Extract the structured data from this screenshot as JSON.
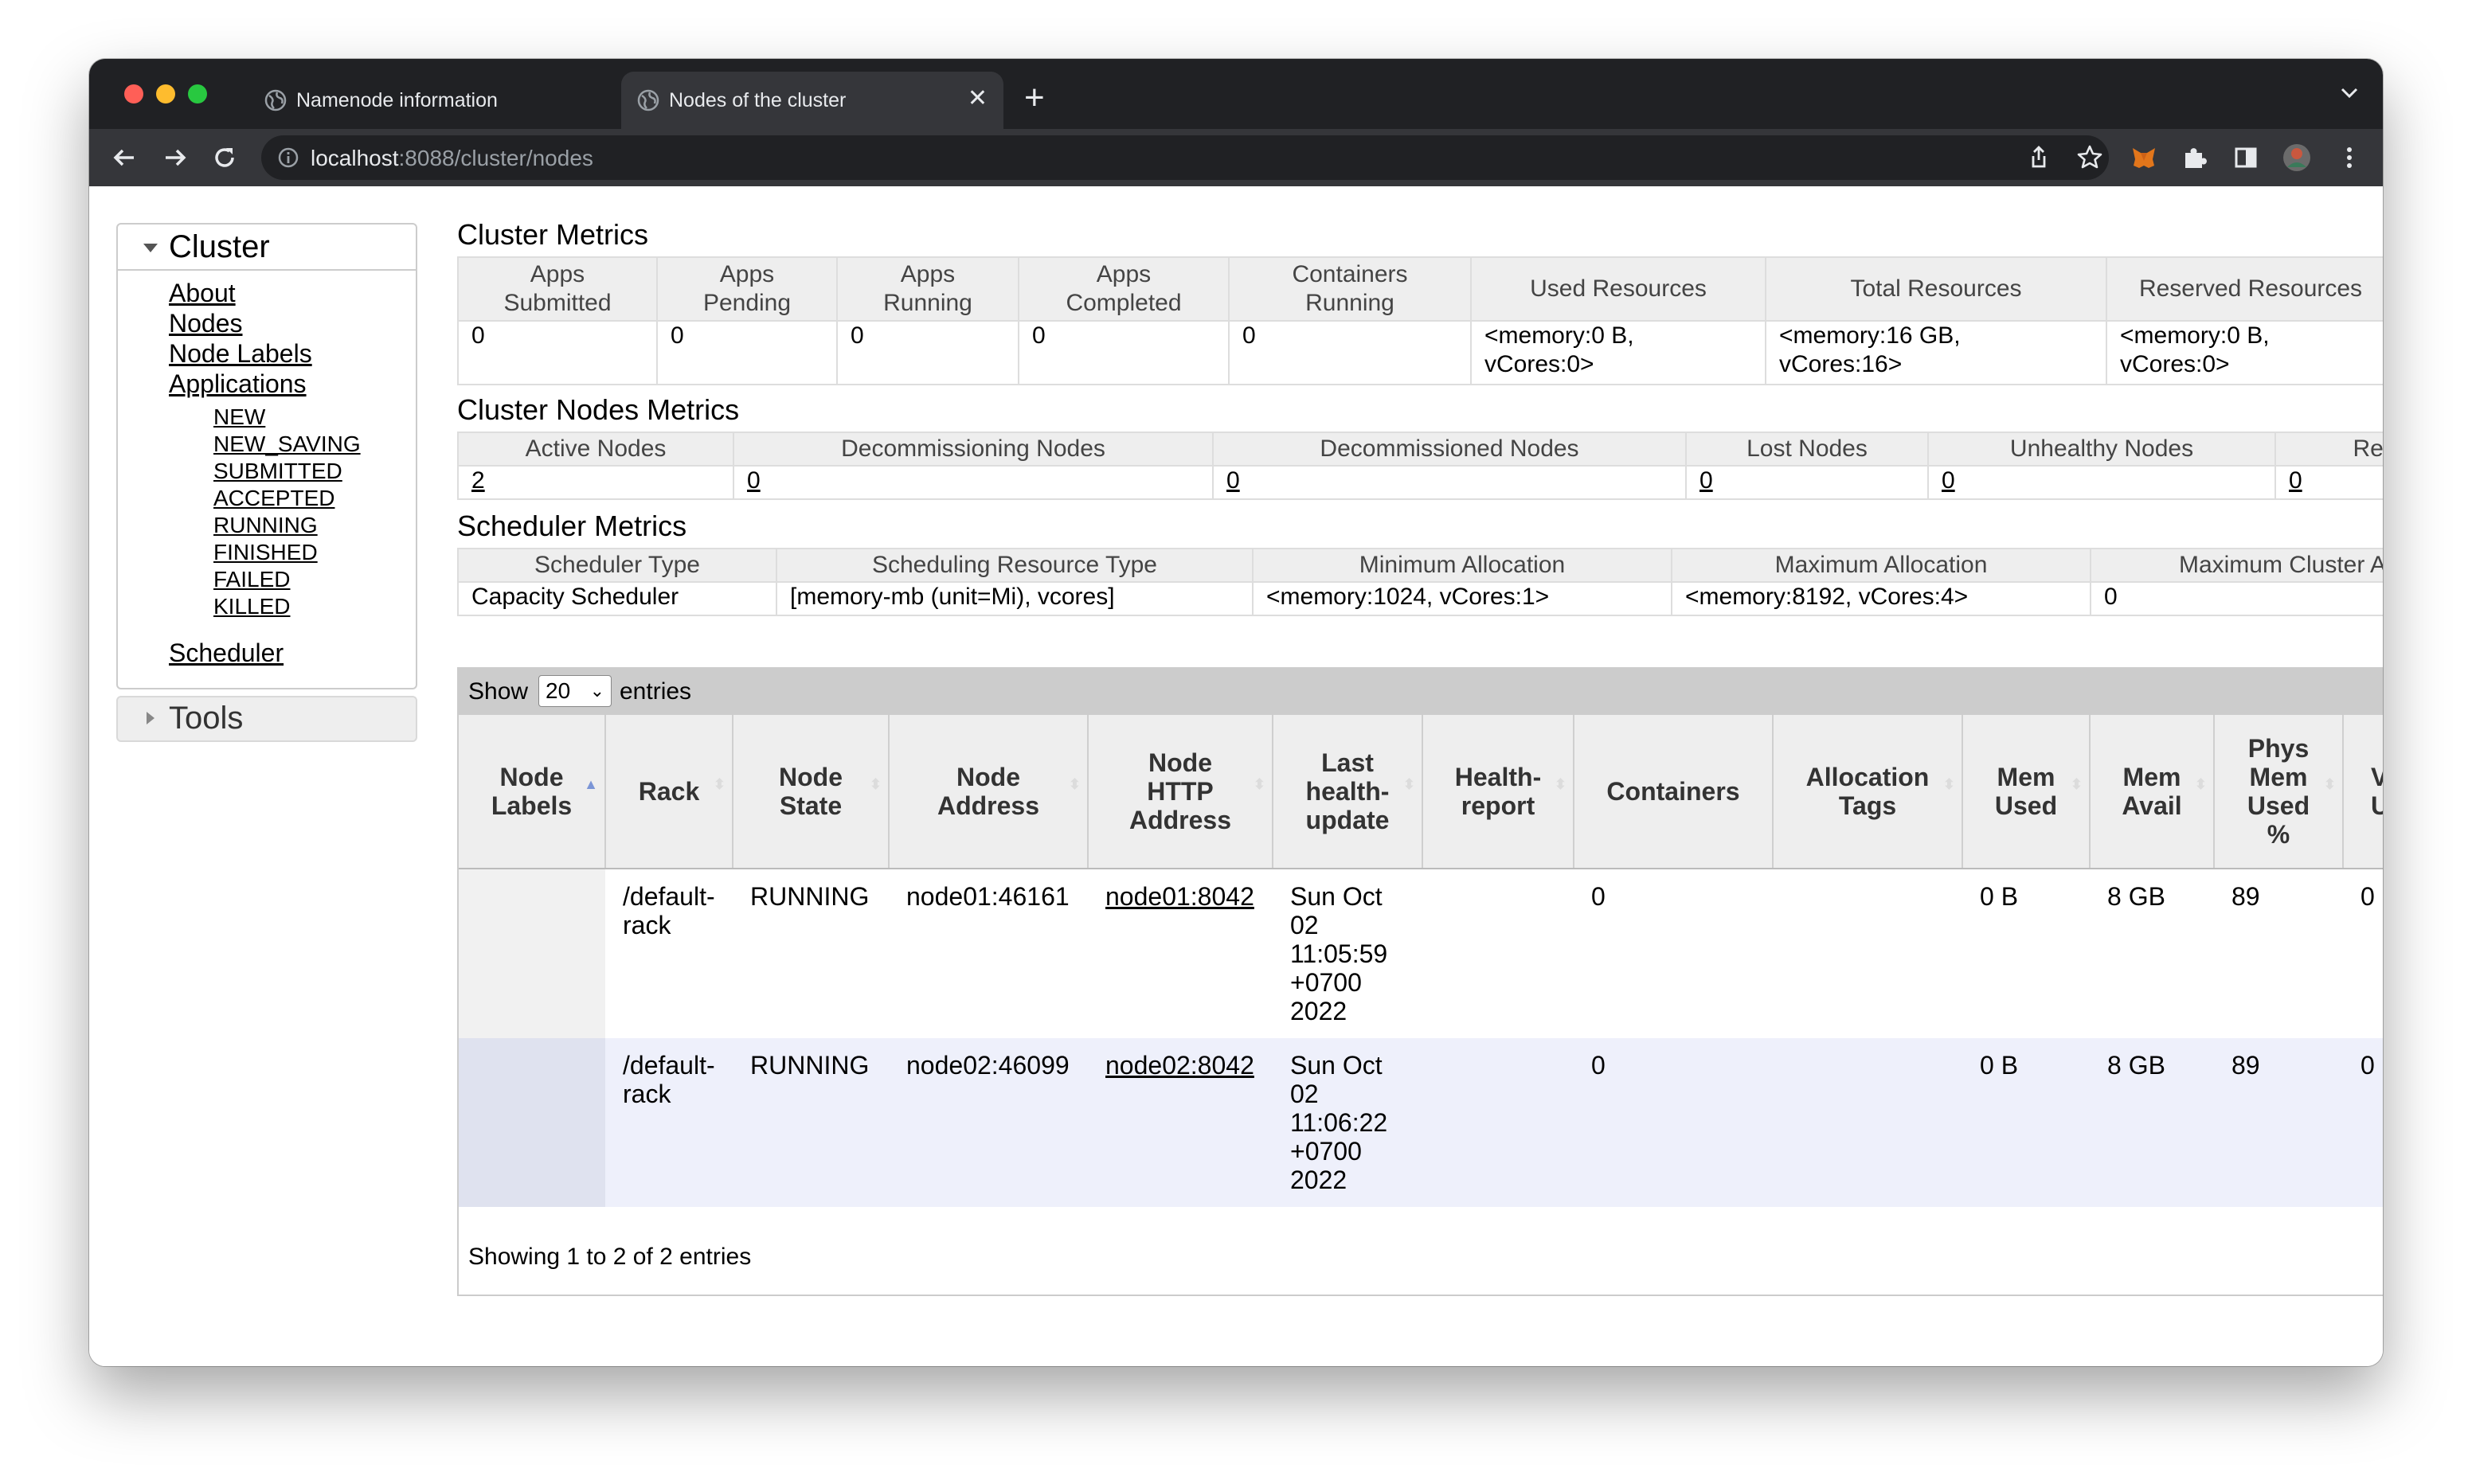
{
  "browser": {
    "tabs": [
      {
        "title": "Namenode information",
        "active": false
      },
      {
        "title": "Nodes of the cluster",
        "active": true
      }
    ],
    "url_host": "localhost",
    "url_rest": ":8088/cluster/nodes"
  },
  "sidebar": {
    "cluster_label": "Cluster",
    "links": [
      "About",
      "Nodes",
      "Node Labels",
      "Applications"
    ],
    "app_states": [
      "NEW",
      "NEW_SAVING",
      "SUBMITTED",
      "ACCEPTED",
      "RUNNING",
      "FINISHED",
      "FAILED",
      "KILLED"
    ],
    "scheduler_label": "Scheduler",
    "tools_label": "Tools"
  },
  "cluster_metrics": {
    "title": "Cluster Metrics",
    "headers": [
      "Apps Submitted",
      "Apps Pending",
      "Apps Running",
      "Apps Completed",
      "Containers Running",
      "Used Resources",
      "Total Resources",
      "Reserved Resources"
    ],
    "values": [
      "0",
      "0",
      "0",
      "0",
      "0",
      "<memory:0 B, vCores:0>",
      "<memory:16 GB, vCores:16>",
      "<memory:0 B, vCores:0>"
    ]
  },
  "nodes_metrics": {
    "title": "Cluster Nodes Metrics",
    "headers": [
      "Active Nodes",
      "Decommissioning Nodes",
      "Decommissioned Nodes",
      "Lost Nodes",
      "Unhealthy Nodes",
      "Reb"
    ],
    "values": [
      "2",
      "0",
      "0",
      "0",
      "0",
      "0"
    ]
  },
  "scheduler_metrics": {
    "title": "Scheduler Metrics",
    "headers": [
      "Scheduler Type",
      "Scheduling Resource Type",
      "Minimum Allocation",
      "Maximum Allocation",
      "Maximum Cluster A"
    ],
    "values": [
      "Capacity Scheduler",
      "[memory-mb (unit=Mi), vcores]",
      "<memory:1024, vCores:1>",
      "<memory:8192, vCores:4>",
      "0"
    ]
  },
  "datatable": {
    "show_label": "Show",
    "entries_value": "20",
    "entries_label": "entries",
    "columns": [
      "Node Labels",
      "Rack",
      "Node State",
      "Node Address",
      "Node HTTP Address",
      "Last health-update",
      "Health-report",
      "Containers",
      "Allocation Tags",
      "Mem Used",
      "Mem Avail",
      "Phys Mem Used %",
      "V U"
    ],
    "rows": [
      [
        "",
        "/default-rack",
        "RUNNING",
        "node01:46161",
        "node01:8042",
        "Sun Oct 02 11:05:59 +0700 2022",
        "",
        "0",
        "",
        "0 B",
        "8 GB",
        "89",
        "0"
      ],
      [
        "",
        "/default-rack",
        "RUNNING",
        "node02:46099",
        "node02:8042",
        "Sun Oct 02 11:06:22 +0700 2022",
        "",
        "0",
        "",
        "0 B",
        "8 GB",
        "89",
        "0"
      ]
    ],
    "info": "Showing 1 to 2 of 2 entries"
  }
}
